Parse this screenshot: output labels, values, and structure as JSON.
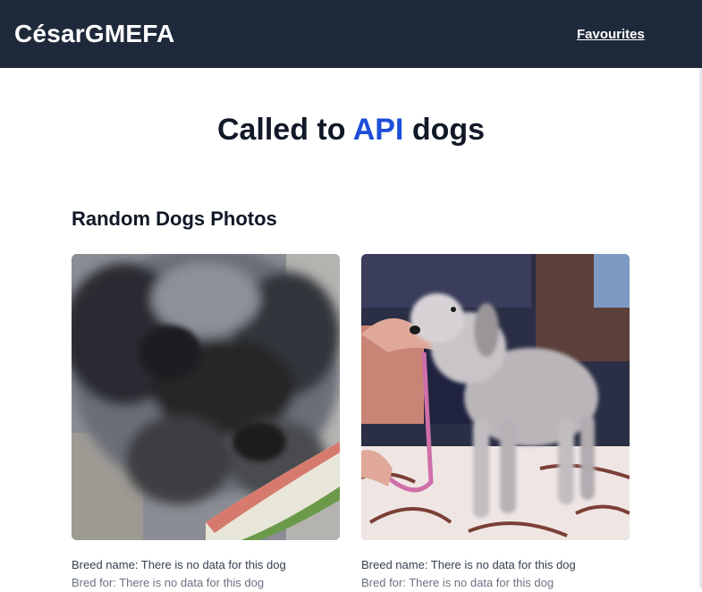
{
  "navbar": {
    "brand": "CésarGMEFA",
    "favourites_link": "Favourites"
  },
  "hero": {
    "title_prefix": "Called to ",
    "title_accent": "API",
    "title_suffix": " dogs"
  },
  "section": {
    "title": "Random Dogs Photos"
  },
  "cards": [
    {
      "breed_name": "Breed name: There is no data for this dog",
      "bred_for": "Bred for: There is no data for this dog"
    },
    {
      "breed_name": "Breed name: There is no data for this dog",
      "bred_for": "Bred for: There is no data for this dog"
    }
  ],
  "colors": {
    "navbar_bg": "#1e293b",
    "accent": "#1d4ed8"
  }
}
